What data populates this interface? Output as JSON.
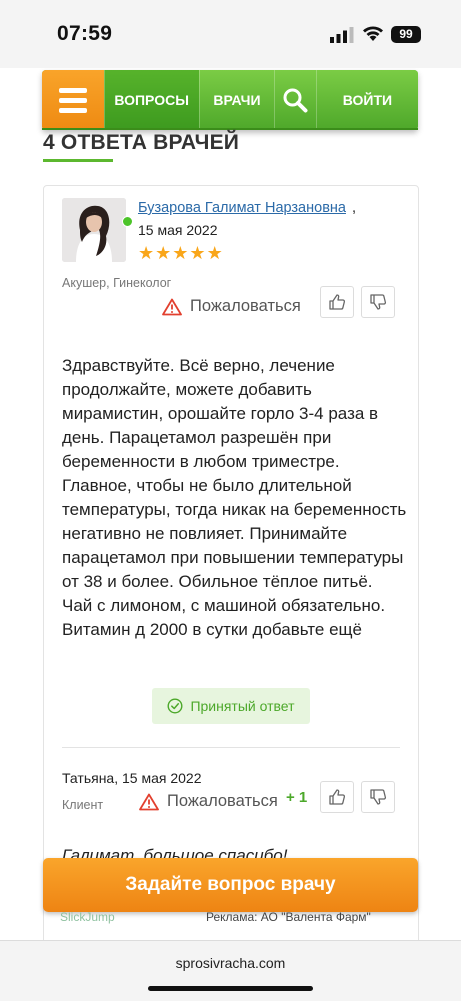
{
  "status_bar": {
    "time": "07:59",
    "battery": "99"
  },
  "nav": {
    "questions": "ВОПРОСЫ",
    "doctors": "ВРАЧИ",
    "login": "ВОЙТИ"
  },
  "section_title": "4 ОТВЕТА ВРАЧЕЙ",
  "answer": {
    "doctor_name": "Бузарова Галимат Нарзановна",
    "comma": ",",
    "date": "15 мая 2022",
    "rating": 5,
    "stars": [
      "★",
      "★",
      "★",
      "★",
      "★"
    ],
    "specialty": "Акушер, Гинеколог",
    "complain_label": "Пожаловаться",
    "text": "Здравствуйте. Всё верно, лечение продолжайте, можете добавить мирамистин, орошайте горло 3-4 раза в день. Парацетамол разрешён при беременности в любом триместре. Главное, чтобы не было длительной температуры, тогда никак на беременность негативно не повлияет. Принимайте парацетамол при повышении температуры от 38 и более. Обильное тёплое питьё. Чай с лимоном, с машиной обязательно. Витамин д 2000 в сутки добавьте ещё",
    "accepted_label": "Принятый ответ"
  },
  "comment": {
    "author_date": "Татьяна, 15 мая 2022",
    "role": "Клиент",
    "complain_label": "Пожаловаться",
    "votes": "+ 1",
    "text": "Галимат, большое спасибо!"
  },
  "cta_label": "Задайте вопрос врачу",
  "ad": {
    "left": "SlickJump",
    "right": "Реклама: АО \"Валента Фарм\""
  },
  "url": "sprosivracha.com",
  "colors": {
    "green": "#5cb82f",
    "orange": "#f39a1f",
    "link": "#2b6aa8"
  }
}
